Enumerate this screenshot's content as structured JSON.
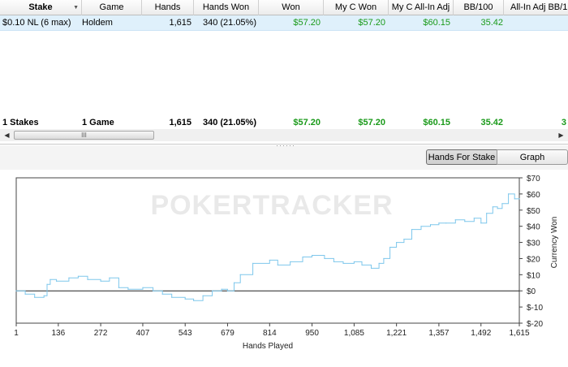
{
  "table": {
    "columns": [
      "Stake",
      "Game",
      "Hands",
      "Hands Won",
      "Won",
      "My C Won",
      "My C All-In Adj",
      "BB/100",
      "All-In Adj BB/1"
    ],
    "rows": [
      {
        "stake": "$0.10 NL (6 max)",
        "game": "Holdem",
        "hands": "1,615",
        "hands_won": "340 (21.05%)",
        "won": "$57.20",
        "my_c_won": "$57.20",
        "my_c_allin_adj": "$60.15",
        "bb100": "35.42"
      }
    ],
    "totals": {
      "stake": "1 Stakes",
      "game": "1 Game",
      "hands": "1,615",
      "hands_won": "340 (21.05%)",
      "won": "$57.20",
      "my_c_won": "$57.20",
      "my_c_allin_adj": "$60.15",
      "bb100": "35.42",
      "allin_adj_partial": "3"
    },
    "scroll_thumb_grip": "III"
  },
  "tabs": {
    "hands_for_stake": "Hands For Stake",
    "graph": "Graph",
    "active": "hands_for_stake"
  },
  "colors": {
    "line": "#7ec7ec",
    "positive": "#1a9a1a",
    "selection": "#dff0fb"
  },
  "chart_data": {
    "type": "line",
    "xlabel": "Hands Played",
    "ylabel": "Currency Won",
    "x_ticks": [
      "1",
      "136",
      "272",
      "407",
      "543",
      "679",
      "814",
      "950",
      "1,085",
      "1,221",
      "1,357",
      "1,492",
      "1,615"
    ],
    "y_ticks": [
      "$70",
      "$60",
      "$50",
      "$40",
      "$30",
      "$20",
      "$10",
      "$0",
      "$-10",
      "$-20"
    ],
    "xlim": [
      1,
      1615
    ],
    "ylim": [
      -20,
      70
    ],
    "zero_line": 0,
    "watermark": "POKERTRACKER",
    "series": [
      {
        "x": [
          1,
          30,
          60,
          90,
          100,
          110,
          130,
          170,
          200,
          230,
          272,
          300,
          330,
          360,
          407,
          440,
          470,
          500,
          543,
          570,
          600,
          630,
          660,
          679,
          700,
          720,
          760,
          814,
          840,
          880,
          920,
          950,
          990,
          1020,
          1050,
          1085,
          1110,
          1140,
          1165,
          1180,
          1200,
          1221,
          1245,
          1270,
          1300,
          1330,
          1357,
          1380,
          1410,
          1440,
          1470,
          1492,
          1510,
          1530,
          1545,
          1560,
          1580,
          1600,
          1615
        ],
        "y": [
          0,
          -2,
          -4,
          -3,
          4,
          7,
          6,
          8,
          9,
          7,
          6,
          8,
          2,
          1,
          2,
          0,
          -2,
          -4,
          -5,
          -6,
          -3,
          0,
          1,
          0,
          5,
          10,
          17,
          19,
          16,
          18,
          21,
          22,
          20,
          18,
          17,
          18,
          16,
          14,
          17,
          20,
          27,
          30,
          32,
          38,
          40,
          41,
          42,
          42,
          44,
          43,
          45,
          42,
          48,
          52,
          51,
          54,
          60,
          57,
          57
        ]
      }
    ]
  }
}
